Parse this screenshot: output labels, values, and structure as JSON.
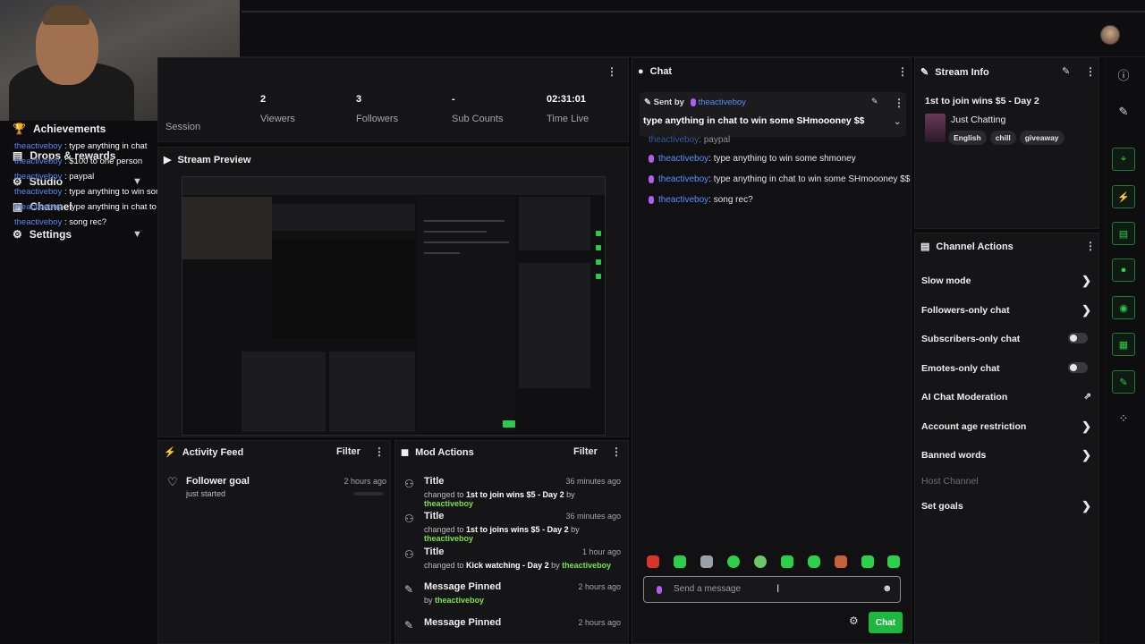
{
  "left_nav": {
    "items": [
      {
        "label": "Achievements",
        "icon": "trophy-icon"
      },
      {
        "label": "Drops & rewards",
        "icon": "gift-icon"
      },
      {
        "label": "Studio",
        "icon": "studio-icon"
      },
      {
        "label": "Channel",
        "icon": "channel-icon"
      },
      {
        "label": "Settings",
        "icon": "gear-icon"
      }
    ],
    "overlay_chat": [
      {
        "user": "theactiveboy",
        "sep": " : ",
        "text": "type anything in chat"
      },
      {
        "user": "theactiveboy",
        "sep": " : ",
        "text": "$100 to one person"
      },
      {
        "user": "theactiveboy",
        "sep": " : ",
        "text": "paypal"
      },
      {
        "user": "theactiveboy",
        "sep": " : ",
        "text": "type anything to win some shmoney"
      },
      {
        "user": "theactiveboy",
        "sep": " : ",
        "text": "type anything in chat to win some SHmoooney $$"
      },
      {
        "user": "theactiveboy",
        "sep": " : ",
        "text": "song rec?"
      }
    ]
  },
  "stats": {
    "session_label": "Session",
    "items": [
      {
        "value": "2",
        "label": "Viewers"
      },
      {
        "value": "3",
        "label": "Followers"
      },
      {
        "value": "-",
        "label": "Sub Counts"
      },
      {
        "value": "02:31:01",
        "label": "Time Live"
      }
    ]
  },
  "preview": {
    "title": "Stream Preview"
  },
  "activity": {
    "title": "Activity Feed",
    "filter": "Filter",
    "items": [
      {
        "title": "Follower goal",
        "sub": "just started",
        "time": "2 hours ago"
      }
    ]
  },
  "mod_actions": {
    "title": "Mod Actions",
    "filter": "Filter",
    "items": [
      {
        "title": "Title",
        "pre": "changed to ",
        "value": "1st to join wins $5 - Day 2",
        "by": " by ",
        "user": "theactiveboy",
        "time": "36 minutes ago"
      },
      {
        "title": "Title",
        "pre": "changed to ",
        "value": "1st to joins wins $5 - Day 2",
        "by": " by ",
        "user": "theactiveboy",
        "time": "36 minutes ago"
      },
      {
        "title": "Title",
        "pre": "changed to ",
        "value": "Kick watching - Day 2",
        "by": " by ",
        "user": "theactiveboy",
        "time": "1 hour ago"
      },
      {
        "title": "Message Pinned",
        "pre": "by ",
        "value": "",
        "by": "",
        "user": "theactiveboy",
        "time": "2 hours ago"
      },
      {
        "title": "Message Pinned",
        "pre": "",
        "value": "",
        "by": "",
        "user": "",
        "time": "2 hours ago"
      }
    ]
  },
  "chat": {
    "title": "Chat",
    "pinned": {
      "sent_by": "Sent by",
      "user": "theactiveboy",
      "text": "type anything in chat to win some SHmoooney $$"
    },
    "partial_line": {
      "user": "theactiveboy",
      "text": ": paypal"
    },
    "messages": [
      {
        "user": "theactiveboy",
        "text": ": type anything to win some shmoney"
      },
      {
        "user": "theactiveboy",
        "text": ": type anything in chat to win some SHmoooney $$"
      },
      {
        "user": "theactiveboy",
        "text": ": song rec?"
      }
    ],
    "input_placeholder": "Send a message",
    "send_label": "Chat"
  },
  "stream_info": {
    "title": "Stream Info",
    "stream_title": "1st to join wins $5 - Day 2",
    "category": "Just Chatting",
    "tags": [
      "English",
      "chill",
      "giveaway"
    ]
  },
  "channel_actions": {
    "title": "Channel Actions",
    "items": [
      {
        "label": "Slow mode",
        "control": "chevron"
      },
      {
        "label": "Followers-only chat",
        "control": "chevron"
      },
      {
        "label": "Subscribers-only chat",
        "control": "toggle"
      },
      {
        "label": "Emotes-only chat",
        "control": "toggle"
      },
      {
        "label": "AI Chat Moderation",
        "control": "external"
      },
      {
        "label": "Account age restriction",
        "control": "chevron"
      },
      {
        "label": "Banned words",
        "control": "chevron"
      },
      {
        "label": "Host Channel",
        "control": "none"
      },
      {
        "label": "Set goals",
        "control": "chevron"
      }
    ]
  },
  "colors": {
    "accent_green": "#2bd14a",
    "username_blue": "#5b8cff",
    "mic_purple": "#b25cf0"
  }
}
